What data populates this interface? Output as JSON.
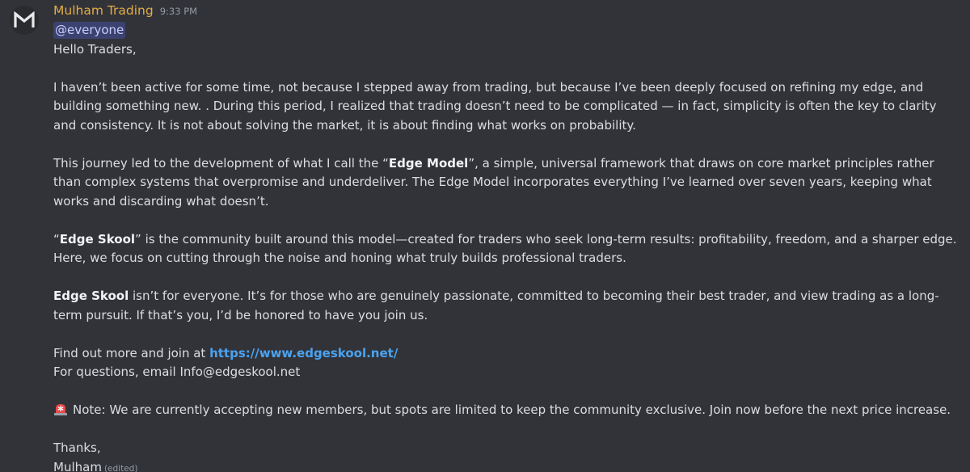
{
  "message": {
    "author": "Mulham Trading",
    "timestamp": "9:33 PM",
    "mention": "@everyone",
    "greeting": "Hello Traders,",
    "p1": "I haven’t been active for some time, not because I stepped away from trading, but because I’ve been deeply focused on refining my edge, and building something new. . During this period, I realized that trading doesn’t need to be complicated — in fact, simplicity is often the key to clarity and consistency. It is not about solving the market, it is about finding what works on probability.",
    "p2_before": "This journey led to the development of what I call the “",
    "p2_bold": "Edge Model",
    "p2_after": "”, a simple, universal framework that draws on core market principles rather than complex systems that overpromise and underdeliver. The Edge Model incorporates everything I’ve learned over seven years, keeping what works and discarding what doesn’t.",
    "p3_before": "“",
    "p3_bold": "Edge Skool",
    "p3_after": "” is the community built around this model—created for traders who seek long-term results: profitability, freedom, and a sharper edge. Here, we focus on cutting through the noise and honing what truly builds professional traders.",
    "p4_bold": "Edge Skool",
    "p4_after": " isn’t for everyone. It’s for those who are genuinely passionate, committed to becoming their best trader, and view trading as a long-term pursuit. If that’s you, I’d be honored to have you join us.",
    "find_out": "Find out more and join at ",
    "link": "https://www.edgeskool.net/",
    "questions": "For questions, email Info@edgeskool.net",
    "note": "Note: We are currently accepting new members, but spots are limited to keep the community exclusive. Join now before the next price increase.",
    "thanks": "Thanks,",
    "signature": "Mulham",
    "edited": "(edited)"
  },
  "icons": {
    "avatar": "m-logo-icon",
    "note": "siren-icon"
  },
  "colors": {
    "background": "#323339",
    "author": "#e2ae46",
    "link": "#4aa3f0",
    "mention_bg": "#3c4270"
  }
}
